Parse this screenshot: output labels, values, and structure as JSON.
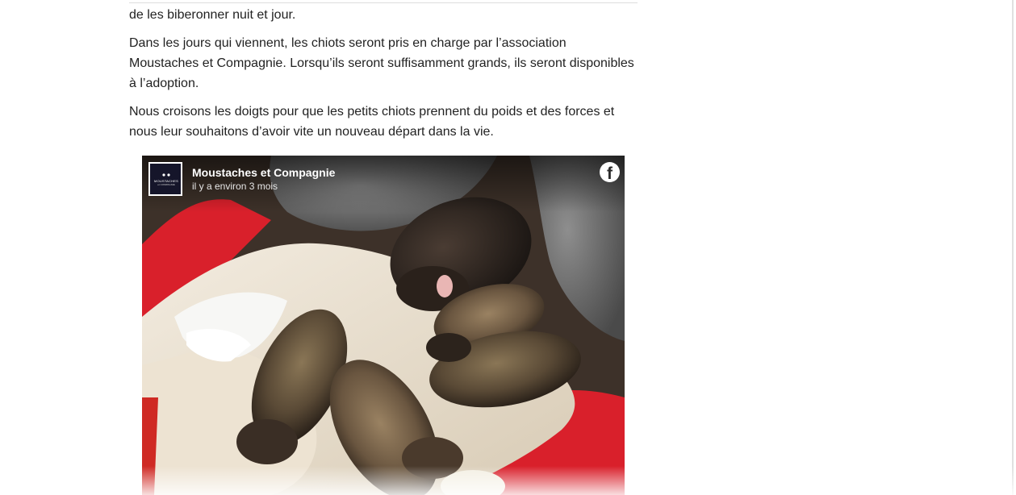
{
  "article": {
    "line_top": "de les biberonner nuit et jour.",
    "paragraph_2": [
      "Dans les jours qui viennent, les chiots seront pris en charge par l’association",
      "Moustaches et Compagnie. Lorsqu’ils seront suffisamment grands, ils seront disponibles",
      "à l’adoption."
    ],
    "paragraph_3": [
      "Nous croisons les doigts pour que les petits chiots prennent du poids et des forces et",
      "nous leur souhaitons d’avoir vite un nouveau départ dans la vie."
    ]
  },
  "embed": {
    "page_name": "Moustaches et Compagnie",
    "timestamp": "il y a environ 3 mois",
    "avatar_text": "MOUSTACHES",
    "avatar_subtext": "et COMPAGNIE",
    "platform_icon": "facebook-icon",
    "photo_subject": "newborn-puppies-photo"
  },
  "colors": {
    "text": "#222222",
    "embed_header_text": "#ffffff",
    "avatar_bg": "#15152a",
    "blanket_red": "#d9202b"
  }
}
